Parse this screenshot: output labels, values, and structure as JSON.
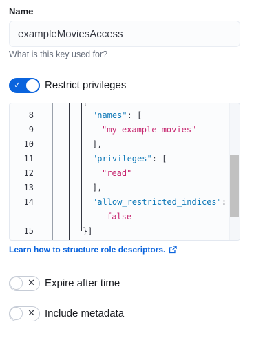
{
  "name_field": {
    "label": "Name",
    "value": "exampleMoviesAccess",
    "help": "What is this key used for?"
  },
  "restrict_privileges": {
    "label": "Restrict privileges",
    "checked": true,
    "glyph": "✓"
  },
  "editor": {
    "top_fragment": "{",
    "lines": [
      {
        "num": "8",
        "key": "\"names\"",
        "rest": ": ["
      },
      {
        "num": "9",
        "str": "\"my-example-movies\""
      },
      {
        "num": "10",
        "punct": "],"
      },
      {
        "num": "11",
        "key": "\"privileges\"",
        "rest": ": ["
      },
      {
        "num": "12",
        "str": "\"read\""
      },
      {
        "num": "13",
        "punct": "],"
      },
      {
        "num": "14",
        "key": "\"allow_restricted_indices\"",
        "rest": ":"
      },
      {
        "num": "",
        "str": "false"
      },
      {
        "num": "15",
        "punct": "}]"
      }
    ]
  },
  "link": {
    "text": "Learn how to structure role descriptors.",
    "icon": "external-link-icon"
  },
  "expire_toggle": {
    "label": "Expire after time",
    "checked": false,
    "glyph": "✕"
  },
  "metadata_toggle": {
    "label": "Include metadata",
    "checked": false,
    "glyph": "✕"
  },
  "colors": {
    "accent": "#0b64dd",
    "json_key": "#0e78b7",
    "json_string": "#c6256e"
  }
}
